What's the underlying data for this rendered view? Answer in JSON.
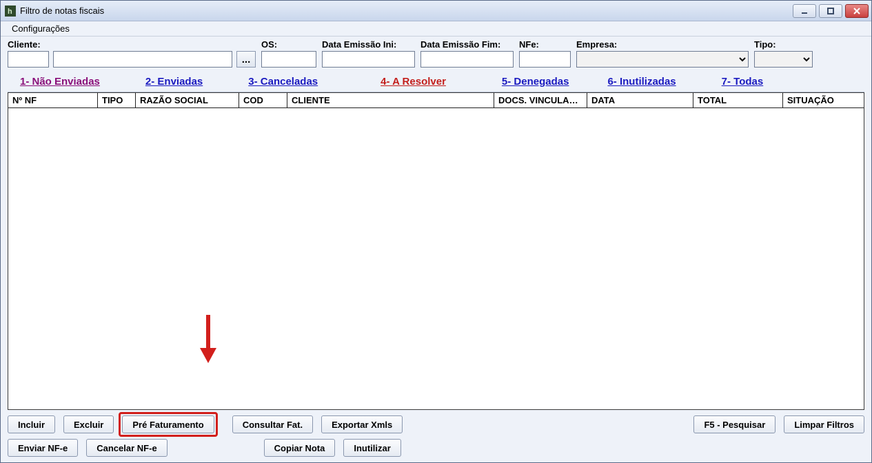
{
  "window": {
    "title": "Filtro de notas fiscais"
  },
  "menu": {
    "config": "Configurações"
  },
  "filters": {
    "cliente_label": "Cliente:",
    "cliente_code": "",
    "cliente_name": "",
    "lookup": "...",
    "os_label": "OS:",
    "os": "",
    "emissao_ini_label": "Data Emissão Ini:",
    "emissao_ini": "",
    "emissao_fim_label": "Data Emissão Fim:",
    "emissao_fim": "",
    "nfe_label": "NFe:",
    "nfe": "",
    "empresa_label": "Empresa:",
    "empresa": "",
    "tipo_label": "Tipo:",
    "tipo": ""
  },
  "tabs": {
    "t1": "1- Não Enviadas",
    "t2": "2- Enviadas",
    "t3": "3- Canceladas",
    "t4": "4- A Resolver",
    "t5": "5- Denegadas",
    "t6": "6- Inutilizadas",
    "t7": "7- Todas"
  },
  "grid": {
    "headers": {
      "nf": "Nº NF",
      "tipo": "TIPO",
      "razao": "RAZÃO SOCIAL",
      "cod": "COD",
      "cliente": "CLIENTE",
      "docs": "DOCS. VINCULADOS",
      "data": "DATA",
      "total": "TOTAL",
      "situacao": "SITUAÇÃO"
    },
    "rows": []
  },
  "buttons": {
    "incluir": "Incluir",
    "excluir": "Excluir",
    "pre_faturamento": "Pré Faturamento",
    "consultar_fat": "Consultar Fat.",
    "exportar_xmls": "Exportar Xmls",
    "f5_pesquisar": "F5 - Pesquisar",
    "limpar_filtros": "Limpar Filtros",
    "enviar_nfe": "Enviar NF-e",
    "cancelar_nfe": "Cancelar NF-e",
    "copiar_nota": "Copiar Nota",
    "inutilizar": "Inutilizar"
  },
  "annotation": {
    "color": "#d21f1c"
  }
}
